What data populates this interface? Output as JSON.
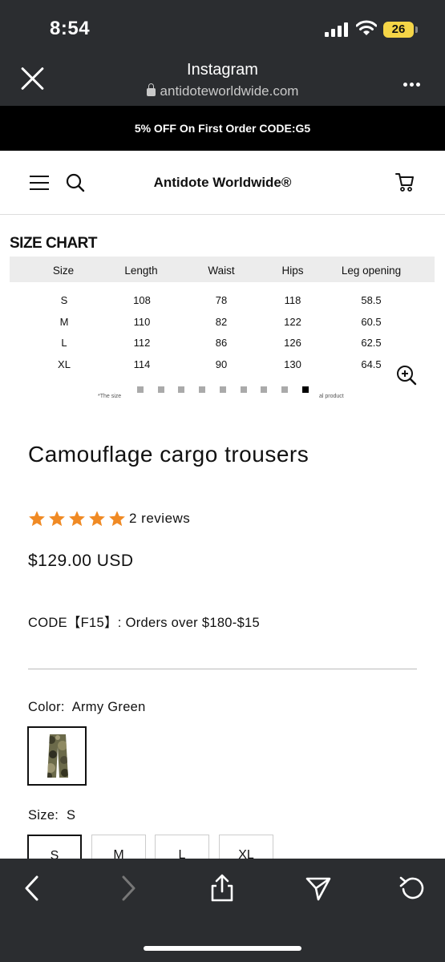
{
  "status_bar": {
    "time": "8:54",
    "battery": "26"
  },
  "browser": {
    "title": "Instagram",
    "url": "antidoteworldwide.com"
  },
  "promo": {
    "text": "5% OFF On First Order CODE:G5"
  },
  "site": {
    "brand": "Antidote Worldwide®"
  },
  "size_chart": {
    "title": "SIZE CHART",
    "headers": [
      "Size",
      "Length",
      "Waist",
      "Hips",
      "Leg opening"
    ],
    "rows": [
      [
        "S",
        "108",
        "78",
        "118",
        "58.5"
      ],
      [
        "M",
        "110",
        "82",
        "122",
        "60.5"
      ],
      [
        "L",
        "112",
        "86",
        "126",
        "62.5"
      ],
      [
        "XL",
        "114",
        "90",
        "130",
        "64.5"
      ]
    ],
    "note_left": "*The size",
    "note_right": "al product",
    "carousel_active_index": 8,
    "carousel_count": 9
  },
  "product": {
    "title": "Camouflage cargo trousers",
    "rating": 5,
    "reviews": "2 reviews",
    "price": "$129.00 USD",
    "code_note": "CODE【F15】: Orders over $180-$15",
    "color_label": "Color:",
    "color_value": "Army Green",
    "size_label": "Size:",
    "size_value": "S",
    "sizes": [
      "S",
      "M",
      "L",
      "XL"
    ]
  },
  "icons": {
    "close": "close-icon",
    "lock": "lock-icon",
    "more": "more-icon",
    "menu": "hamburger-icon",
    "search": "search-icon",
    "cart": "cart-icon",
    "zoom": "zoom-in-icon",
    "star": "star-icon",
    "back": "chevron-left-icon",
    "forward": "chevron-right-icon",
    "share": "share-icon",
    "send": "send-icon",
    "reload": "reload-icon"
  },
  "colors": {
    "dark_bar": "#2b2d30",
    "promo_bg": "#000000",
    "star": "#f08a24",
    "battery": "#f5d547"
  }
}
